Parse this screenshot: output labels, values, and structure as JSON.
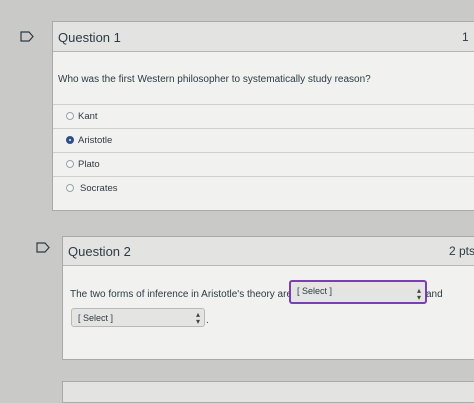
{
  "question1": {
    "title": "Question 1",
    "points": "1",
    "prompt": "Who was the first Western philosopher to systematically study reason?",
    "options": [
      {
        "label": "Kant",
        "selected": false
      },
      {
        "label": "Aristotle",
        "selected": true
      },
      {
        "label": "Plato",
        "selected": false
      },
      {
        "label": "Socrates",
        "selected": false
      }
    ]
  },
  "question2": {
    "title": "Question 2",
    "points": "2 pts",
    "prompt_before": "The two forms of inference in Aristotle's theory are",
    "prompt_between": "and",
    "prompt_after": ".",
    "select1_value": "[ Select ]",
    "select2_value": "[ Select ]"
  },
  "colors": {
    "accent_selected_radio": "#2f4f87",
    "focus_outline": "#7a3fb0"
  }
}
